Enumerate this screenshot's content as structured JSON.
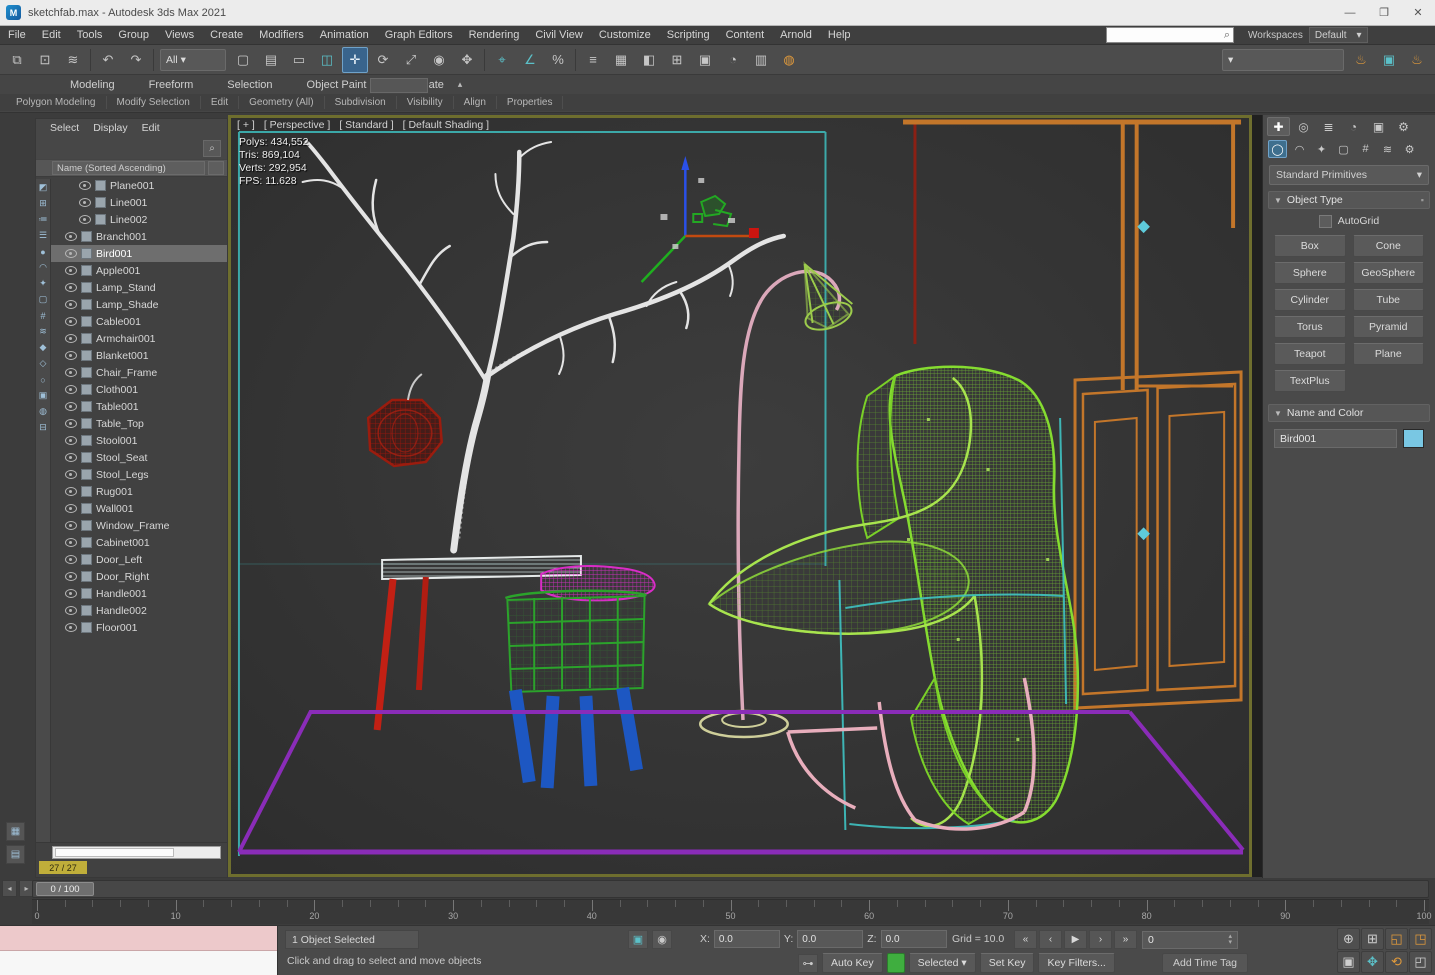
{
  "window": {
    "title": "sketchfab.max - Autodesk 3ds Max 2021",
    "app_icon_letter": "M",
    "controls": [
      {
        "n": "minimize-button",
        "g": "—"
      },
      {
        "n": "maximize-button",
        "g": "❐"
      },
      {
        "n": "close-button",
        "g": "✕"
      }
    ]
  },
  "menu_bar": {
    "items": [
      "File",
      "Edit",
      "Tools",
      "Group",
      "Views",
      "Create",
      "Modifiers",
      "Animation",
      "Graph Editors",
      "Rendering",
      "Civil View",
      "Customize",
      "Scripting",
      "Content",
      "Arnold",
      "Help"
    ],
    "search_placeholder": "",
    "workspaces_label": "Workspaces",
    "workspace_current": "Default"
  },
  "toolbar": {
    "icons": [
      {
        "n": "select-and-link",
        "g": "⧉"
      },
      {
        "n": "unlink-selection",
        "g": "⊡"
      },
      {
        "n": "bind-to-space-warp",
        "g": "≋"
      },
      {
        "n": "sep"
      },
      {
        "n": "undo",
        "g": "↶"
      },
      {
        "n": "redo",
        "g": "↷"
      },
      {
        "n": "sep"
      },
      {
        "n": "selection-filter-dropdown",
        "g": "All",
        "dd": true
      },
      {
        "n": "select-object",
        "g": "▢"
      },
      {
        "n": "select-by-name",
        "g": "▤"
      },
      {
        "n": "rectangular-selection-region",
        "g": "▭"
      },
      {
        "n": "window-crossing-toggle",
        "g": "◫",
        "c": "#5bc0c8"
      },
      {
        "n": "select-and-move",
        "g": "✛",
        "active": true
      },
      {
        "n": "select-and-rotate",
        "g": "⟳"
      },
      {
        "n": "select-and-scale",
        "g": "⤢"
      },
      {
        "n": "use-pivot-point-center",
        "g": "◉"
      },
      {
        "n": "select-and-manipulate",
        "g": "✥"
      },
      {
        "n": "sep"
      },
      {
        "n": "snaps-toggle",
        "g": "⌖",
        "c": "#5bc0c8"
      },
      {
        "n": "angle-snap-toggle",
        "g": "∠",
        "c": "#5bc0c8"
      },
      {
        "n": "percent-snap-toggle",
        "g": "%"
      },
      {
        "n": "sep"
      },
      {
        "n": "edit-named-selection-sets",
        "g": "≡"
      },
      {
        "n": "mirror",
        "g": "▦"
      },
      {
        "n": "align",
        "g": "◧"
      },
      {
        "n": "toggle-scene-explorer",
        "g": "⊞"
      },
      {
        "n": "toggle-layer-explorer",
        "g": "▣"
      },
      {
        "n": "curve-editor",
        "g": "◔"
      },
      {
        "n": "schematic-view",
        "g": "▥"
      },
      {
        "n": "material-editor",
        "g": "◍",
        "c": "#e09a3c"
      }
    ],
    "right_icons": [
      {
        "n": "render-preset-dropdown",
        "g": "▾",
        "dd": true
      },
      {
        "n": "render-setup",
        "g": "♨",
        "c": "#e09a3c"
      },
      {
        "n": "rendered-frame-window",
        "g": "▣",
        "c": "#5bc0c8"
      },
      {
        "n": "render-production",
        "g": "♨",
        "c": "#e09a3c"
      }
    ]
  },
  "ribbon": {
    "tabs": [
      "Modeling",
      "Freeform",
      "Selection",
      "Object Paint",
      "Populate"
    ],
    "panels": [
      "Polygon Modeling",
      "Modify Selection",
      "Edit",
      "Geometry (All)",
      "Subdivision",
      "Visibility",
      "Align",
      "Properties"
    ],
    "collapse_glyph": "▴"
  },
  "scene_explorer": {
    "menu": [
      "Select",
      "Display",
      "Edit"
    ],
    "search_icon": "⌕",
    "column_header": "Name (Sorted Ascending)",
    "status_badge": "27 / 27",
    "filters": [
      {
        "n": "explorer-sort-hierarchy",
        "g": "◩"
      },
      {
        "n": "explorer-expand-all",
        "g": "⊞"
      },
      {
        "n": "explorer-list-view",
        "g": "≔"
      },
      {
        "n": "explorer-display-menu",
        "g": "☰"
      },
      {
        "n": "explorer-filter-geometry",
        "g": "●"
      },
      {
        "n": "explorer-filter-shapes",
        "g": "◠"
      },
      {
        "n": "explorer-filter-lights",
        "g": "✦"
      },
      {
        "n": "explorer-filter-cameras",
        "g": "▢"
      },
      {
        "n": "explorer-filter-helpers",
        "g": "#"
      },
      {
        "n": "explorer-filter-spacewarps",
        "g": "≋"
      },
      {
        "n": "explorer-filter-groups",
        "g": "◆"
      },
      {
        "n": "explorer-filter-xrefs",
        "g": "◇"
      },
      {
        "n": "explorer-filter-bones",
        "g": "○"
      },
      {
        "n": "explorer-filter-containers",
        "g": "▣"
      },
      {
        "n": "explorer-filter-materials",
        "g": "◍"
      },
      {
        "n": "explorer-filter-frozen",
        "g": "⊟"
      }
    ],
    "rows": [
      {
        "name": "Plane001",
        "indent": 2
      },
      {
        "name": "Line001",
        "indent": 2
      },
      {
        "name": "Line002",
        "indent": 2
      },
      {
        "name": "Branch001",
        "indent": 1
      },
      {
        "name": "Bird001",
        "indent": 1,
        "selected": true
      },
      {
        "name": "Apple001",
        "indent": 1
      },
      {
        "name": "Lamp_Stand",
        "indent": 1
      },
      {
        "name": "Lamp_Shade",
        "indent": 1
      },
      {
        "name": "Cable001",
        "indent": 1
      },
      {
        "name": "Armchair001",
        "indent": 1
      },
      {
        "name": "Blanket001",
        "indent": 1
      },
      {
        "name": "Chair_Frame",
        "indent": 1
      },
      {
        "name": "Cloth001",
        "indent": 1
      },
      {
        "name": "Table001",
        "indent": 1
      },
      {
        "name": "Table_Top",
        "indent": 1
      },
      {
        "name": "Stool001",
        "indent": 1
      },
      {
        "name": "Stool_Seat",
        "indent": 1
      },
      {
        "name": "Stool_Legs",
        "indent": 1
      },
      {
        "name": "Rug001",
        "indent": 1
      },
      {
        "name": "Wall001",
        "indent": 1
      },
      {
        "name": "Window_Frame",
        "indent": 1
      },
      {
        "name": "Cabinet001",
        "indent": 1
      },
      {
        "name": "Door_Left",
        "indent": 1
      },
      {
        "name": "Door_Right",
        "indent": 1
      },
      {
        "name": "Handle001",
        "indent": 1
      },
      {
        "name": "Handle002",
        "indent": 1
      },
      {
        "name": "Floor001",
        "indent": 1
      }
    ]
  },
  "viewport": {
    "label_tokens": [
      "[ + ]",
      "[ Perspective ]",
      "[ Standard ]",
      "[ Default Shading ]"
    ],
    "stats_lines": [
      "Polys: 434,552",
      "Tris: 869,104",
      "Verts: 292,954"
    ],
    "fps_line": "FPS: 11.628"
  },
  "command_panel": {
    "tabs": [
      {
        "n": "tab-create",
        "g": "✚",
        "active": true
      },
      {
        "n": "tab-modify",
        "g": "◎"
      },
      {
        "n": "tab-hierarchy",
        "g": "≣"
      },
      {
        "n": "tab-motion",
        "g": "◔"
      },
      {
        "n": "tab-display",
        "g": "▣"
      },
      {
        "n": "tab-utilities",
        "g": "⚙"
      }
    ],
    "categories": [
      {
        "n": "category-geometry",
        "g": "◯",
        "active": true
      },
      {
        "n": "category-shapes",
        "g": "◠"
      },
      {
        "n": "category-lights",
        "g": "✦"
      },
      {
        "n": "category-cameras",
        "g": "▢"
      },
      {
        "n": "category-helpers",
        "g": "#"
      },
      {
        "n": "category-space-warps",
        "g": "≋"
      },
      {
        "n": "category-systems",
        "g": "⚙"
      }
    ],
    "subcategory_dropdown": "Standard Primitives",
    "object_type": {
      "title": "Object Type",
      "autogrid_label": "AutoGrid",
      "buttons": [
        "Box",
        "Cone",
        "Sphere",
        "GeoSphere",
        "Cylinder",
        "Tube",
        "Torus",
        "Pyramid",
        "Teapot",
        "Plane",
        "TextPlus"
      ]
    },
    "name_and_color": {
      "title": "Name and Color",
      "name_value": "Bird001",
      "swatch_color": "#79c7e3"
    }
  },
  "timeline": {
    "slider_value": "0 / 100",
    "tick_labels": [
      0,
      10,
      20,
      30,
      40,
      50,
      60,
      70,
      80,
      90,
      100
    ],
    "frame_start": 0,
    "frame_end": 100
  },
  "status_bar": {
    "selection_status": "1 Object Selected",
    "prompt": "Click and drag to select and move objects",
    "toggles": [
      {
        "n": "isolate-selection-toggle",
        "g": "▣",
        "c": "#5bc0c8"
      },
      {
        "n": "selection-lock-toggle",
        "g": "◉"
      }
    ],
    "coord_labels": [
      "X:",
      "Y:",
      "Z:"
    ],
    "coord_values": [
      "0.0",
      "0.0",
      "0.0"
    ],
    "grid_label": "Grid = 10.0",
    "set_key_icon": "⊶",
    "auto_key_label": "Auto Key",
    "selected_label": "Selected",
    "set_key_label": "Set Key",
    "key_filters_label": "Key Filters...",
    "add_time_tag": "Add Time Tag",
    "frame_value": "0",
    "playback": [
      {
        "n": "go-to-start",
        "g": "«"
      },
      {
        "n": "previous-frame",
        "g": "‹"
      },
      {
        "n": "play-animation",
        "g": "▶"
      },
      {
        "n": "next-frame",
        "g": "›"
      },
      {
        "n": "go-to-end",
        "g": "»"
      }
    ],
    "nav_icons": [
      {
        "n": "zoom",
        "g": "⊕",
        "c": "#cfcfcf"
      },
      {
        "n": "zoom-all",
        "g": "⊞",
        "c": "#cfcfcf"
      },
      {
        "n": "zoom-extents",
        "g": "◱",
        "c": "#e09a3c"
      },
      {
        "n": "zoom-extents-all",
        "g": "◳",
        "c": "#e09a3c"
      },
      {
        "n": "zoom-region",
        "g": "▣",
        "c": "#cfcfcf"
      },
      {
        "n": "pan-view",
        "g": "✥",
        "c": "#5bc0c8"
      },
      {
        "n": "orbit-viewport",
        "g": "⟲",
        "c": "#e09a3c"
      },
      {
        "n": "maximize-viewport-toggle",
        "g": "◰",
        "c": "#cfcfcf"
      }
    ]
  }
}
